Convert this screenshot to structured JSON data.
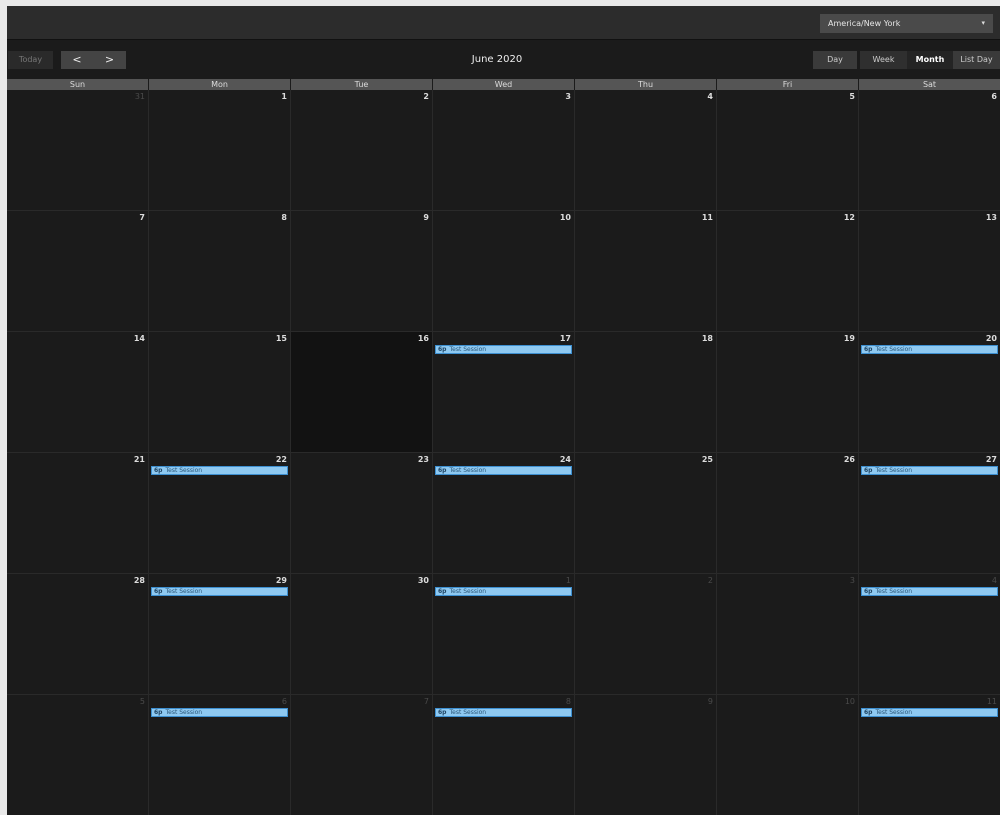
{
  "topbar": {
    "timezone": "America/New York",
    "caret": "▾"
  },
  "toolbar": {
    "today": "Today",
    "prev": "<",
    "next": ">",
    "title": "June 2020",
    "views": [
      "Day",
      "Week",
      "Month",
      "List Day"
    ]
  },
  "weekdays": [
    "Sun",
    "Mon",
    "Tue",
    "Wed",
    "Thu",
    "Fri",
    "Sat"
  ],
  "weeks": [
    [
      {
        "day": "31",
        "other": true,
        "events": []
      },
      {
        "day": "1",
        "events": []
      },
      {
        "day": "2",
        "events": []
      },
      {
        "day": "3",
        "events": []
      },
      {
        "day": "4",
        "events": []
      },
      {
        "day": "5",
        "events": []
      },
      {
        "day": "6",
        "events": []
      }
    ],
    [
      {
        "day": "7",
        "events": []
      },
      {
        "day": "8",
        "events": []
      },
      {
        "day": "9",
        "events": []
      },
      {
        "day": "10",
        "events": []
      },
      {
        "day": "11",
        "events": []
      },
      {
        "day": "12",
        "events": []
      },
      {
        "day": "13",
        "events": []
      }
    ],
    [
      {
        "day": "14",
        "events": []
      },
      {
        "day": "15",
        "events": []
      },
      {
        "day": "16",
        "today": true,
        "events": []
      },
      {
        "day": "17",
        "events": [
          {
            "time": "6p",
            "title": "Test Session"
          }
        ]
      },
      {
        "day": "18",
        "events": []
      },
      {
        "day": "19",
        "events": []
      },
      {
        "day": "20",
        "events": [
          {
            "time": "6p",
            "title": "Test Session"
          }
        ]
      }
    ],
    [
      {
        "day": "21",
        "events": []
      },
      {
        "day": "22",
        "events": [
          {
            "time": "6p",
            "title": "Test Session"
          }
        ]
      },
      {
        "day": "23",
        "events": []
      },
      {
        "day": "24",
        "events": [
          {
            "time": "6p",
            "title": "Test Session"
          }
        ]
      },
      {
        "day": "25",
        "events": []
      },
      {
        "day": "26",
        "events": []
      },
      {
        "day": "27",
        "events": [
          {
            "time": "6p",
            "title": "Test Session"
          }
        ]
      }
    ],
    [
      {
        "day": "28",
        "events": []
      },
      {
        "day": "29",
        "events": [
          {
            "time": "6p",
            "title": "Test Session"
          }
        ]
      },
      {
        "day": "30",
        "events": []
      },
      {
        "day": "1",
        "other": true,
        "events": [
          {
            "time": "6p",
            "title": "Test Session"
          }
        ]
      },
      {
        "day": "2",
        "other": true,
        "events": []
      },
      {
        "day": "3",
        "other": true,
        "events": []
      },
      {
        "day": "4",
        "other": true,
        "events": [
          {
            "time": "6p",
            "title": "Test Session"
          }
        ]
      }
    ],
    [
      {
        "day": "5",
        "other": true,
        "events": []
      },
      {
        "day": "6",
        "other": true,
        "events": [
          {
            "time": "6p",
            "title": "Test Session"
          }
        ]
      },
      {
        "day": "7",
        "other": true,
        "events": []
      },
      {
        "day": "8",
        "other": true,
        "events": [
          {
            "time": "6p",
            "title": "Test Session"
          }
        ]
      },
      {
        "day": "9",
        "other": true,
        "events": []
      },
      {
        "day": "10",
        "other": true,
        "events": []
      },
      {
        "day": "11",
        "other": true,
        "events": [
          {
            "time": "6p",
            "title": "Test Session"
          }
        ]
      }
    ]
  ]
}
